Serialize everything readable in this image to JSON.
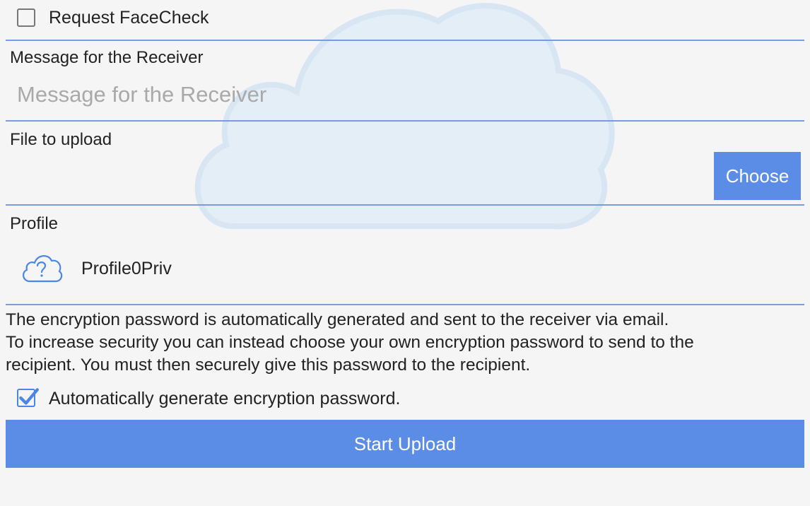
{
  "facecheck": {
    "label": "Request FaceCheck",
    "checked": false
  },
  "message": {
    "label": "Message for the Receiver",
    "placeholder": "Message for the Receiver",
    "value": ""
  },
  "file": {
    "label": "File to upload",
    "choose_label": "Choose"
  },
  "profile": {
    "label": "Profile",
    "icon": "cloud-question-icon",
    "name": "Profile0Priv"
  },
  "info": {
    "line1": "The encryption password is automatically generated and sent to the receiver via email.",
    "line2": "To increase security you can instead choose your own encryption password to send to the",
    "line3": "recipient. You must then securely give this password to the recipient."
  },
  "auto_password": {
    "label": "Automatically generate encryption password.",
    "checked": true
  },
  "actions": {
    "start_upload_label": "Start Upload"
  },
  "colors": {
    "accent": "#5b8de6",
    "divider": "#7b9be0",
    "background": "#f5f5f5",
    "cloud_watermark": "#dce9f5"
  }
}
